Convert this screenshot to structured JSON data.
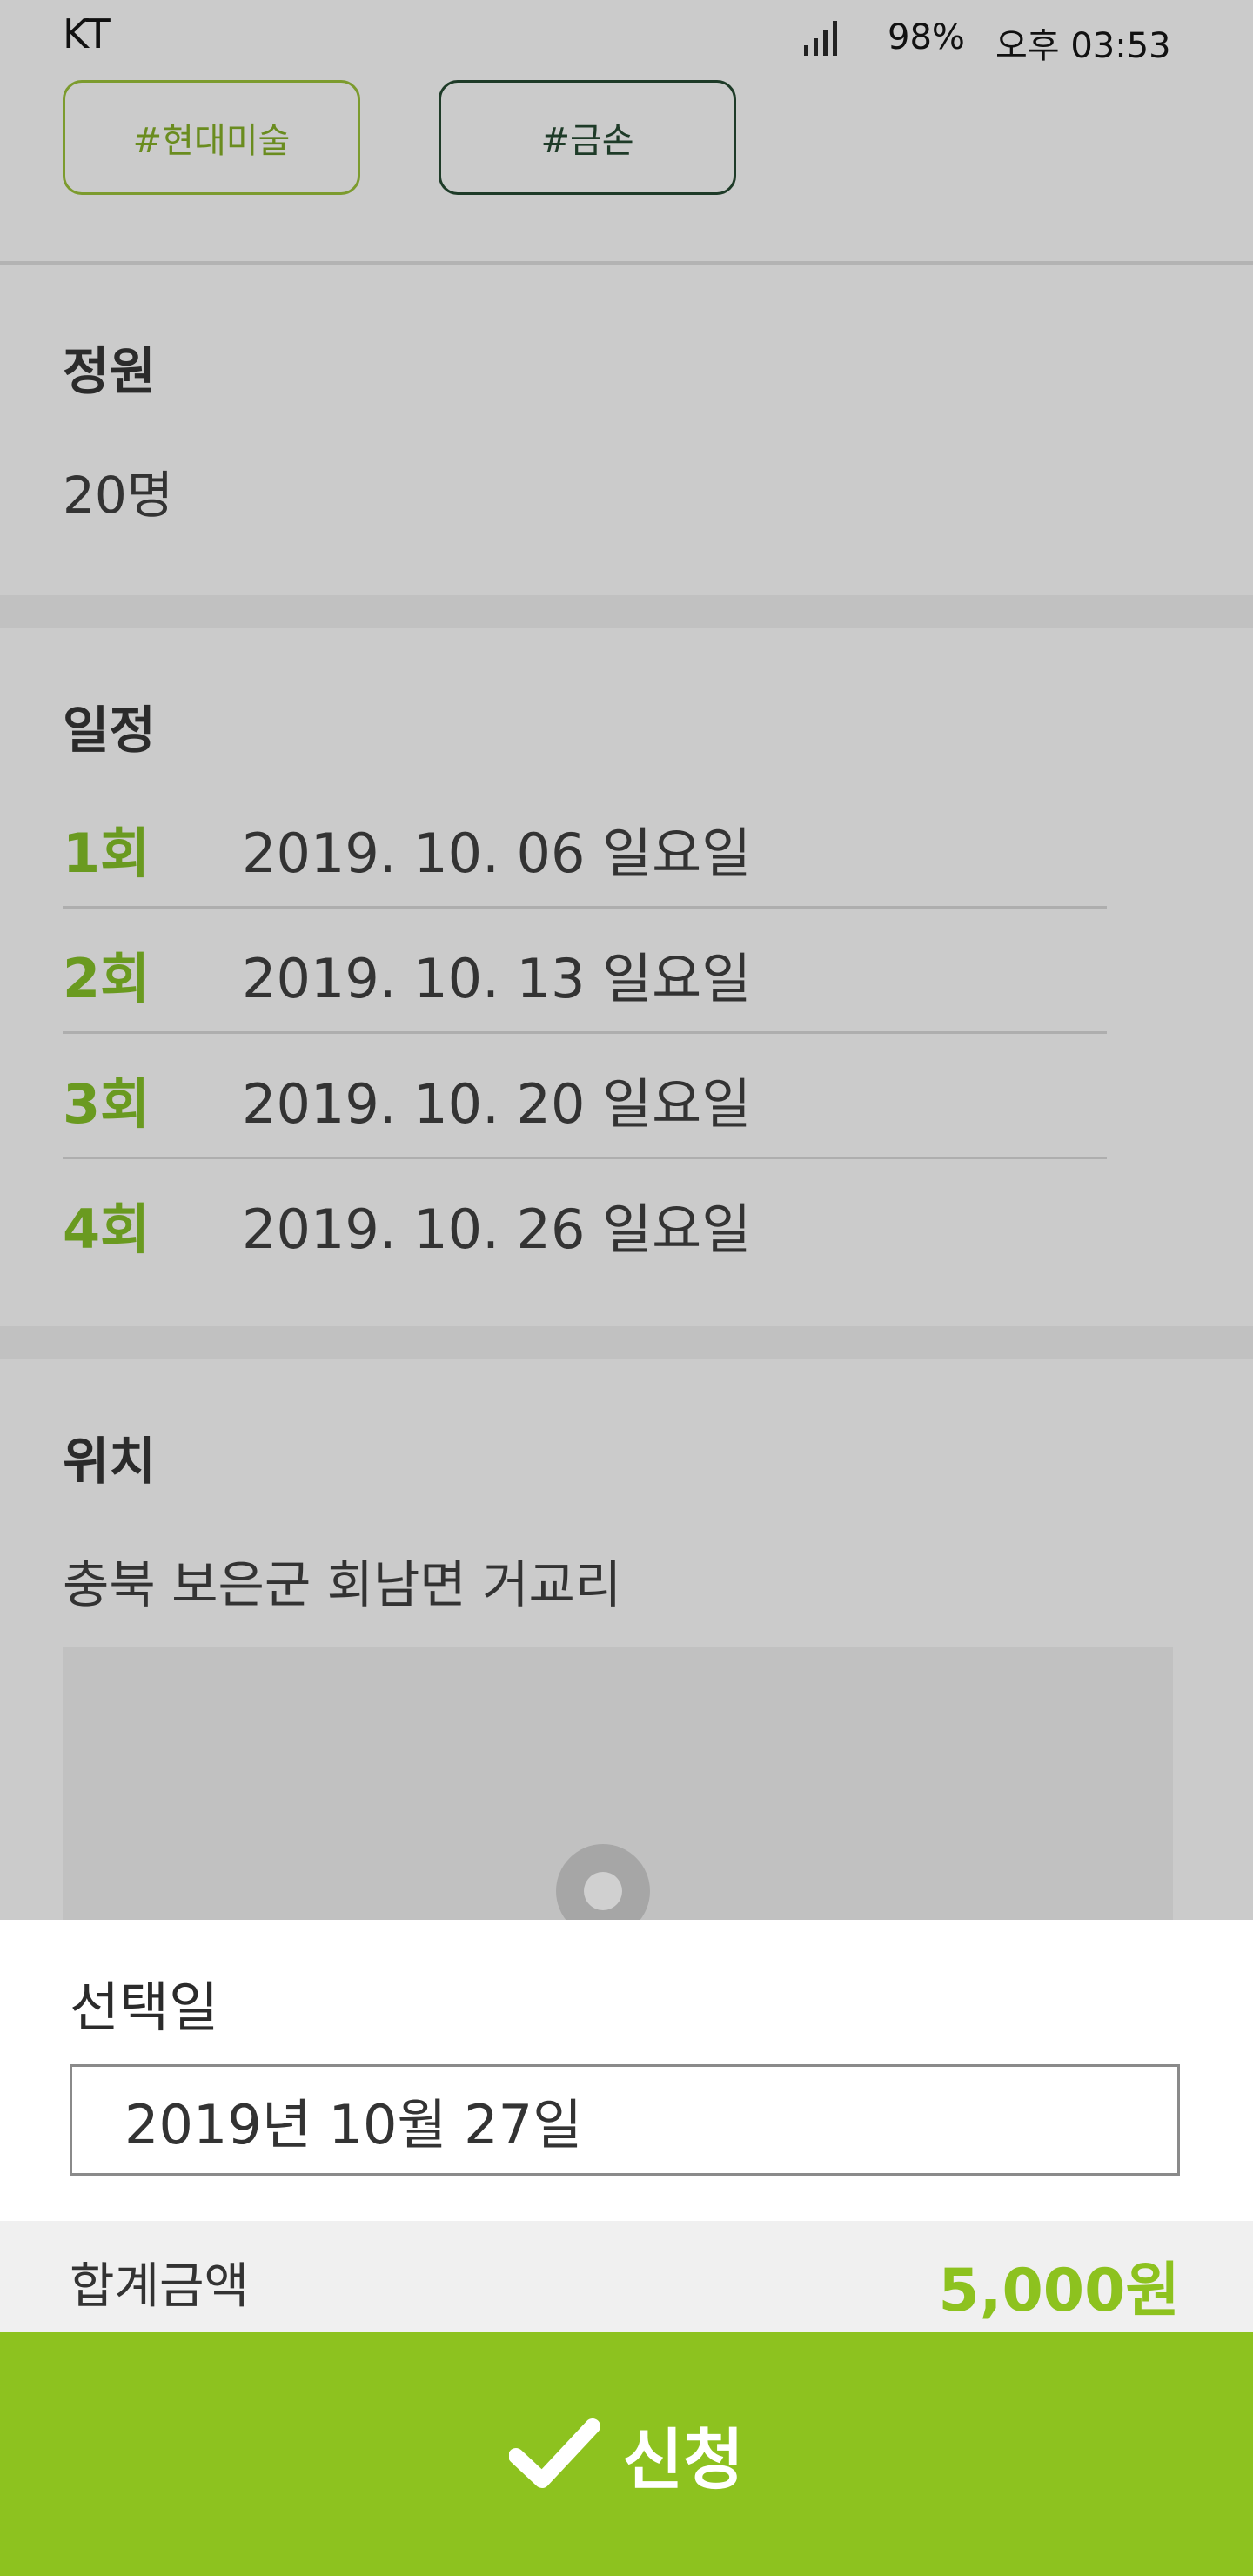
{
  "status_bar": {
    "carrier": "KT",
    "battery": "98%",
    "time": "오후 03:53"
  },
  "tags": [
    "#현대미술",
    "#금손"
  ],
  "capacity": {
    "label": "정원",
    "value": "20명"
  },
  "schedule": {
    "label": "일정",
    "items": [
      {
        "num": "1회",
        "date": "2019. 10. 06 일요일"
      },
      {
        "num": "2회",
        "date": "2019. 10. 13 일요일"
      },
      {
        "num": "3회",
        "date": "2019. 10. 20 일요일"
      },
      {
        "num": "4회",
        "date": "2019. 10. 26 일요일"
      }
    ]
  },
  "location": {
    "label": "위치",
    "address": "충북 보은군 회남면 거교리",
    "map_icon": "map-pin-icon"
  },
  "bottom": {
    "selected_label": "선택일",
    "selected_date": "2019년 10월 27일",
    "total_label": "합계금액",
    "total_amount": "5,000원",
    "apply_label": "신청",
    "apply_icon": "check-icon"
  },
  "colors": {
    "accent": "#8dc21f",
    "schedule_number": "#6a9a20",
    "tag_green": "#7c9b2e",
    "tag_dark": "#1e3b28"
  }
}
